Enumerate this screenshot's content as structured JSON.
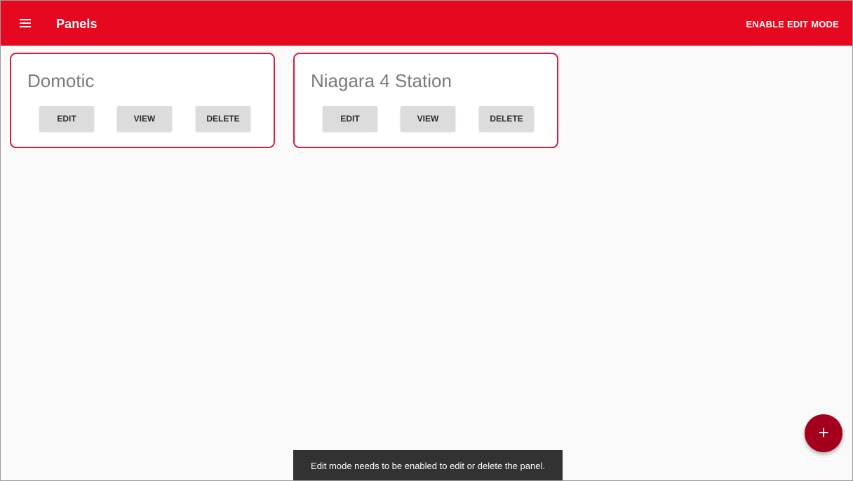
{
  "appbar": {
    "title": "Panels",
    "menu_icon": "menu-icon",
    "edit_mode_label": "ENABLE EDIT MODE",
    "color": "#e5081f"
  },
  "panels": [
    {
      "title": "Domotic",
      "buttons": {
        "edit": "EDIT",
        "view": "VIEW",
        "delete": "DELETE"
      }
    },
    {
      "title": "Niagara 4 Station",
      "buttons": {
        "edit": "EDIT",
        "view": "VIEW",
        "delete": "DELETE"
      }
    }
  ],
  "fab": {
    "icon": "plus-icon",
    "symbol": "+"
  },
  "snackbar": {
    "message": "Edit mode needs to be enabled to edit or delete the panel."
  },
  "colors": {
    "primary": "#e5081f",
    "card_border": "#d81b3b",
    "fab": "#a4001d",
    "snackbar": "#323232"
  }
}
